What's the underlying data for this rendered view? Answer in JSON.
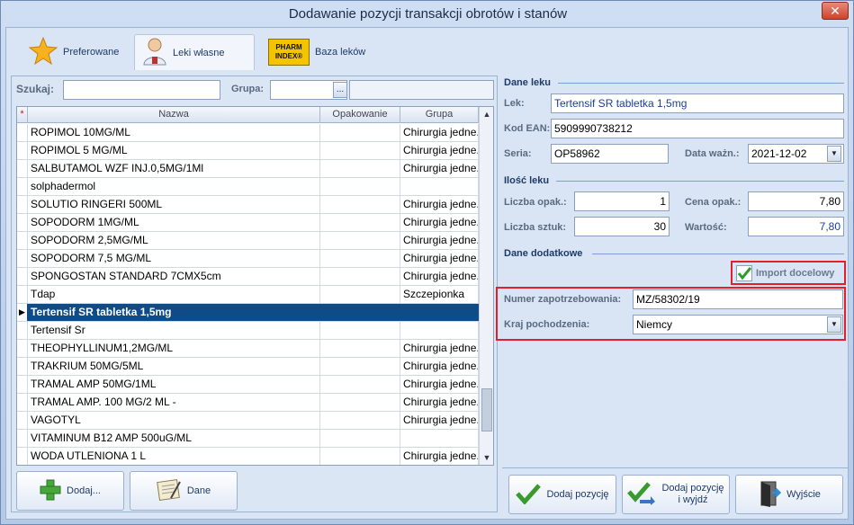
{
  "window": {
    "title": "Dodawanie pozycji transakcji obrotów i stanów",
    "close_glyph": "✕"
  },
  "tabs": [
    {
      "label": "Preferowane",
      "icon": "star-icon",
      "active": false
    },
    {
      "label": "Leki własne",
      "icon": "user-doctor-icon",
      "active": true
    },
    {
      "label": "Baza leków",
      "icon": "pharmindex-logo-icon",
      "active": false
    }
  ],
  "pharm_logo_text": "PHARM INDEX®",
  "search": {
    "label": "Szukaj:",
    "value": "",
    "group_label": "Grupa:",
    "group_value": "",
    "browse": "..."
  },
  "grid": {
    "columns": [
      "Nazwa",
      "Opakowanie",
      "Grupa"
    ],
    "marker_header": "*",
    "rows": [
      {
        "name": "ROPIMOL 10MG/ML",
        "pack": "",
        "group": "Chirurgia jedne..."
      },
      {
        "name": "ROPIMOL 5 MG/ML",
        "pack": "",
        "group": "Chirurgia jedne..."
      },
      {
        "name": "SALBUTAMOL WZF INJ.0,5MG/1Ml",
        "pack": "",
        "group": "Chirurgia jedne..."
      },
      {
        "name": "solphadermol",
        "pack": "",
        "group": ""
      },
      {
        "name": "SOLUTIO RINGERI 500ML",
        "pack": "",
        "group": "Chirurgia jedne..."
      },
      {
        "name": "SOPODORM 1MG/ML",
        "pack": "",
        "group": "Chirurgia jedne..."
      },
      {
        "name": "SOPODORM 2,5MG/ML",
        "pack": "",
        "group": "Chirurgia jedne..."
      },
      {
        "name": "SOPODORM 7,5 MG/ML",
        "pack": "",
        "group": "Chirurgia jedne..."
      },
      {
        "name": "SPONGOSTAN STANDARD 7CMX5cm",
        "pack": "",
        "group": "Chirurgia jedne..."
      },
      {
        "name": "Tdap",
        "pack": "",
        "group": "Szczepionka"
      },
      {
        "name": "Tertensif SR tabletka 1,5mg",
        "pack": "",
        "group": "",
        "selected": true
      },
      {
        "name": "Tertensif Sr",
        "pack": "",
        "group": ""
      },
      {
        "name": "THEOPHYLLINUM1,2MG/ML",
        "pack": "",
        "group": "Chirurgia jedne..."
      },
      {
        "name": "TRAKRIUM 50MG/5ML",
        "pack": "",
        "group": "Chirurgia jedne..."
      },
      {
        "name": "TRAMAL AMP 50MG/1ML",
        "pack": "",
        "group": "Chirurgia jedne..."
      },
      {
        "name": "TRAMAL AMP. 100 MG/2 ML -",
        "pack": "",
        "group": "Chirurgia jedne..."
      },
      {
        "name": "VAGOTYL",
        "pack": "",
        "group": "Chirurgia jedne..."
      },
      {
        "name": "VITAMINUM B12 AMP 500uG/ML",
        "pack": "",
        "group": ""
      },
      {
        "name": "WODA UTLENIONA 1 L",
        "pack": "",
        "group": "Chirurgia jedne..."
      }
    ]
  },
  "left_buttons": {
    "add": "Dodaj...",
    "data": "Dane"
  },
  "drug": {
    "section": "Dane leku",
    "lek_label": "Lek:",
    "lek_value": "Tertensif SR tabletka 1,5mg",
    "ean_label": "Kod EAN:",
    "ean_value": "5909990738212",
    "seria_label": "Seria:",
    "seria_value": "OP58962",
    "expiry_label": "Data ważn.:",
    "expiry_value": "2021-12-02"
  },
  "qty": {
    "section": "Ilość leku",
    "packs_label": "Liczba opak.:",
    "packs_value": "1",
    "price_label": "Cena opak.:",
    "price_value": "7,80",
    "pieces_label": "Liczba sztuk:",
    "pieces_value": "30",
    "value_label": "Wartość:",
    "value_value": "7,80"
  },
  "extra": {
    "section": "Dane dodatkowe",
    "import_label": "Import docelowy",
    "import_checked": true,
    "order_label": "Numer zapotrzebowania:",
    "order_value": "MZ/58302/19",
    "country_label": "Kraj pochodzenia:",
    "country_value": "Niemcy"
  },
  "bottom_buttons": {
    "add_position": "Dodaj pozycję",
    "add_exit_1": "Dodaj pozycję",
    "add_exit_2": "i wyjdź",
    "exit": "Wyjście"
  },
  "colors": {
    "selection": "#0f4c87",
    "highlight": "#e0202a",
    "accent": "#1e3a66"
  }
}
